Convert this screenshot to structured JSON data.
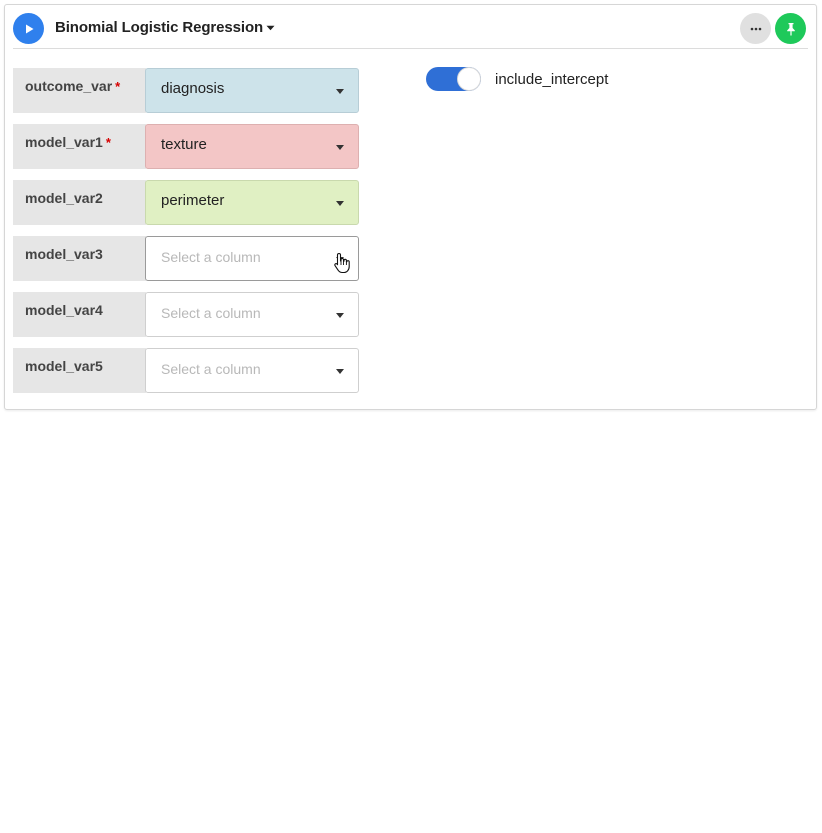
{
  "block": {
    "title": "Binomial Logistic Regression"
  },
  "colors": {
    "run": "#2f80ed",
    "pin": "#1ec95a",
    "outcome_var": "#cde3ea",
    "model_var1": "#f3c6c6",
    "model_var2": "#e0f0c3",
    "toggle_on": "#2f6fd6",
    "required": "#d60000"
  },
  "icons": {
    "run": "play-icon",
    "title_dropdown": "caret-down-icon",
    "menu": "ellipsis-icon",
    "pin": "pin-icon",
    "cursor": "hand-pointer-icon"
  },
  "fields": [
    {
      "label": "outcome_var",
      "required_mark": "*",
      "value": "diagnosis",
      "placeholder": ""
    },
    {
      "label": "model_var1",
      "required_mark": "*",
      "value": "texture",
      "placeholder": ""
    },
    {
      "label": "model_var2",
      "required_mark": "",
      "value": "perimeter",
      "placeholder": ""
    },
    {
      "label": "model_var3",
      "required_mark": "",
      "value": "",
      "placeholder": "Select a column"
    },
    {
      "label": "model_var4",
      "required_mark": "",
      "value": "",
      "placeholder": "Select a column"
    },
    {
      "label": "model_var5",
      "required_mark": "",
      "value": "",
      "placeholder": "Select a column"
    }
  ],
  "toggle": {
    "label": "include_intercept",
    "on": true
  }
}
